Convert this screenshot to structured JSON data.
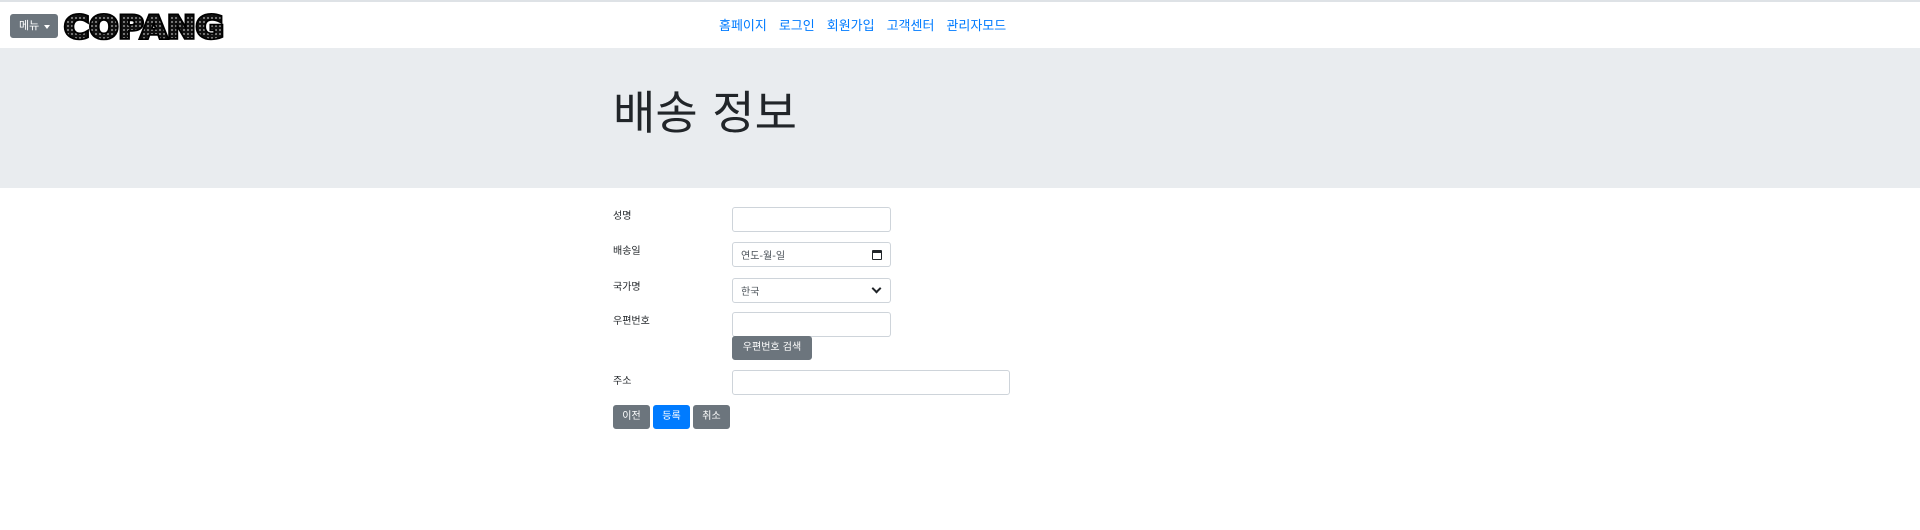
{
  "header": {
    "menu_label": "메뉴",
    "logo_text": "COPANG",
    "nav": [
      "홈페이지",
      "로그인",
      "회원가입",
      "고객센터",
      "관리자모드"
    ]
  },
  "jumbotron": {
    "title": "배송 정보"
  },
  "form": {
    "name_label": "성명",
    "name_value": "",
    "date_label": "배송일",
    "date_placeholder": "연도-월-일",
    "country_label": "국가명",
    "country_selected": "한국",
    "zip_label": "우편번호",
    "zip_value": "",
    "zip_search_button": "우편번호 검색",
    "address_label": "주소",
    "address_value": ""
  },
  "actions": {
    "prev": "이전",
    "submit": "등록",
    "cancel": "취소"
  },
  "colors": {
    "link": "#007bff",
    "primary": "#007bff",
    "secondary": "#6c757d",
    "jumbotron_bg": "#e9ecef"
  }
}
